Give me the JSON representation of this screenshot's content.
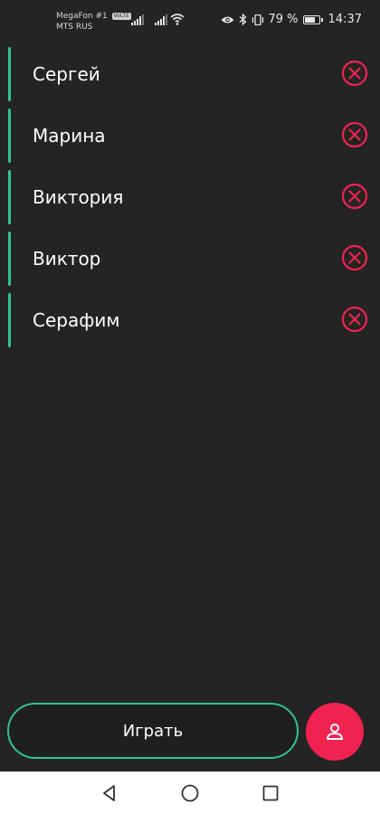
{
  "status_bar": {
    "carrier_primary": "MegaFon #1",
    "carrier_badge": "VoLTE",
    "carrier_secondary": "MTS RUS",
    "battery_text": "79 %",
    "battery_level": 0.79,
    "time": "14:37",
    "icons": [
      "signal-icon",
      "signal-icon",
      "wifi-icon",
      "eye-icon",
      "bluetooth-icon",
      "vibrate-icon",
      "battery-icon"
    ]
  },
  "players": [
    {
      "name": "Сергей"
    },
    {
      "name": "Марина"
    },
    {
      "name": "Виктория"
    },
    {
      "name": "Виктор"
    },
    {
      "name": "Серафим"
    }
  ],
  "actions": {
    "play_label": "Играть",
    "add_player_icon": "person-icon"
  },
  "navigation": {
    "icons": [
      "back-icon",
      "home-icon",
      "recent-apps-icon"
    ]
  },
  "colors": {
    "background": "#242424",
    "accent_green": "#2ec58e",
    "accent_red": "#f0224f",
    "text": "#ffffff"
  }
}
